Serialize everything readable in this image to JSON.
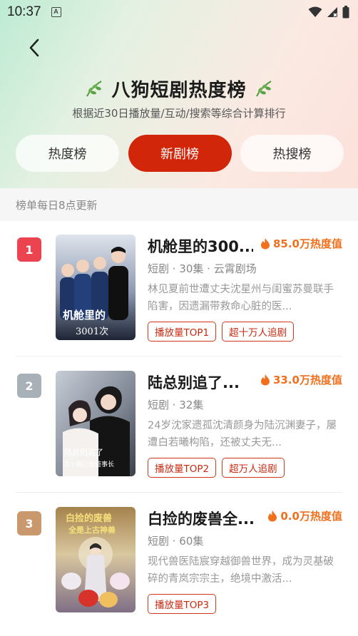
{
  "status_bar": {
    "time": "10:37",
    "app_icon_letter": "A"
  },
  "header": {
    "title": "八狗短剧热度榜",
    "subtitle": "根据近30日播放量/互动/搜索等综合计算排行"
  },
  "tabs": [
    {
      "label": "热度榜",
      "active": false
    },
    {
      "label": "新剧榜",
      "active": true
    },
    {
      "label": "热搜榜",
      "active": false
    }
  ],
  "update_note": "榜单每日8点更新",
  "colors": {
    "accent": "#d2260a",
    "heat": "#f0701e",
    "rank1": "#ec4350",
    "rank2": "#a8b1b8",
    "rank3": "#c9986c"
  },
  "items": [
    {
      "rank": "1",
      "title": "机舱里的300...",
      "heat": "85.0万热度值",
      "meta": "短剧 · 30集 · 云霄剧场",
      "desc": "林见夏前世遭丈夫沈星州与闺蜜苏曼联手陷害，因遗漏带救命心脏的医...",
      "tags": [
        "播放量TOP1",
        "超十万人追剧"
      ],
      "cover_text": [
        "机舱里的",
        "3001次"
      ]
    },
    {
      "rank": "2",
      "title": "陆总别追了...",
      "heat": "33.0万热度值",
      "meta": "短剧 · 32集",
      "desc": "24岁沈家遗孤沈清颜身为陆沉渊妻子，屡遭白若曦构陷，还被丈夫无...",
      "tags": [
        "播放量TOP2",
        "超万人追剧"
      ],
      "cover_text": [
        "陆总别追了",
        "沈小姐已是董事长"
      ]
    },
    {
      "rank": "3",
      "title": "白捡的废兽全...",
      "heat": "0.0万热度值",
      "meta": "短剧 · 60集",
      "desc": "现代兽医陆宸穿越御兽世界，成为灵基破碎的青岚宗宗主，绝境中激活...",
      "tags": [
        "播放量TOP3"
      ],
      "cover_text": [
        "白捡的废兽",
        "全是上古神兽"
      ]
    }
  ]
}
